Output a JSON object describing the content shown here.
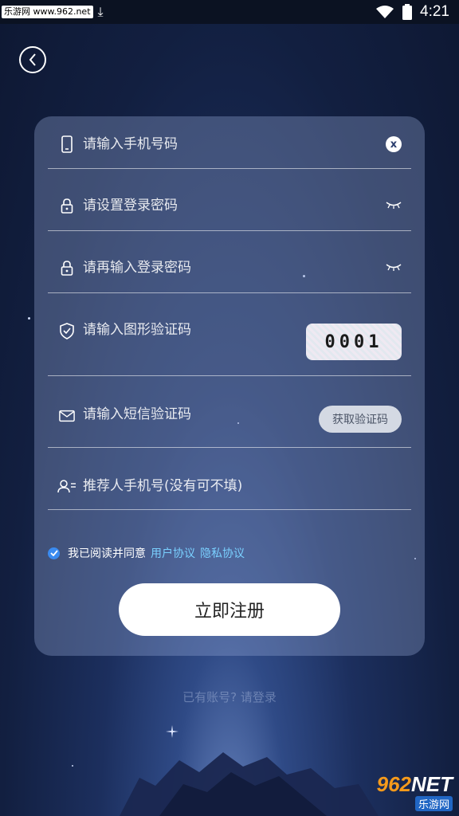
{
  "status_bar": {
    "watermark_text": "乐游网 www.962.net",
    "time": "4:21"
  },
  "form": {
    "phone": {
      "placeholder": "请输入手机号码",
      "clear_symbol": "x"
    },
    "password": {
      "placeholder": "请设置登录密码"
    },
    "password_confirm": {
      "placeholder": "请再输入登录密码"
    },
    "image_captcha": {
      "placeholder": "请输入图形验证码",
      "captcha_text": "0001"
    },
    "sms_code": {
      "placeholder": "请输入短信验证码",
      "button_label": "获取验证码"
    },
    "referrer": {
      "placeholder": "推荐人手机号(没有可不填)"
    },
    "agreement": {
      "checked": true,
      "text": "我已阅读并同意",
      "user_agreement": "用户协议",
      "privacy_policy": "隐私协议"
    },
    "submit_label": "立即注册"
  },
  "login_prompt": "已有账号? 请登录",
  "watermark_logo": {
    "main_number": "962",
    "main_suffix": "NET",
    "sub": "乐游网"
  },
  "colors": {
    "accent_link": "#7ad0ff",
    "checkbox": "#3a8bf0",
    "logo_orange": "#f59a1b"
  }
}
